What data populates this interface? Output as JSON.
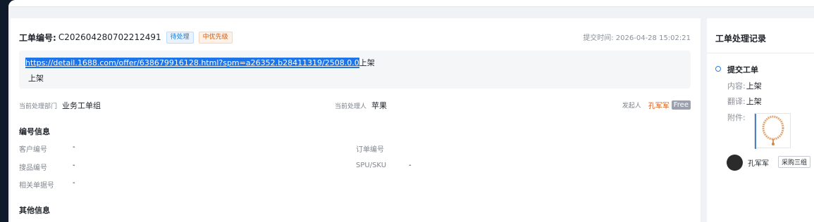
{
  "header": {
    "ticket_label": "工单编号:",
    "ticket_id": "C202604280702212491",
    "status_badge": "待处理",
    "priority_badge": "中优先级",
    "submit_time_label": "提交时间:",
    "submit_time": "2026-04-28 15:02:21"
  },
  "content": {
    "link_text": "https://detail.1688.com/offer/638679916128.html?spm=a26352.b28411319/2508.0.0",
    "link_suffix": "上架",
    "body": "上架"
  },
  "handling": {
    "dept_label": "当前处理部门",
    "dept_value": "业务工单组",
    "handler_label": "当前处理人",
    "handler_value": "苹果",
    "originator_label": "发起人",
    "originator_name": "孔军军",
    "originator_tag": "Free"
  },
  "ids_section": {
    "title": "编号信息",
    "customer_no_label": "客户编号",
    "customer_no_value": "-",
    "order_no_label": "订单编号",
    "order_no_value": "",
    "sourcing_no_label": "搜品编号",
    "sourcing_no_value": "-",
    "spu_label": "SPU/SKU",
    "spu_value": "-",
    "related_doc_label": "相关单据号",
    "related_doc_value": "-"
  },
  "other_section": {
    "title": "其他信息"
  },
  "record_panel": {
    "title": "工单处理记录",
    "event_title": "提交工单",
    "content_label": "内容:",
    "content_value": "上架",
    "translation_label": "翻译:",
    "translation_value": "上架",
    "attachment_label": "附件:",
    "user_name": "孔军军",
    "user_group": "采购三组"
  },
  "colors": {
    "status_blue": "#1e7bd6",
    "priority_orange": "#d25a17",
    "link_highlight": "#1f74e8"
  }
}
